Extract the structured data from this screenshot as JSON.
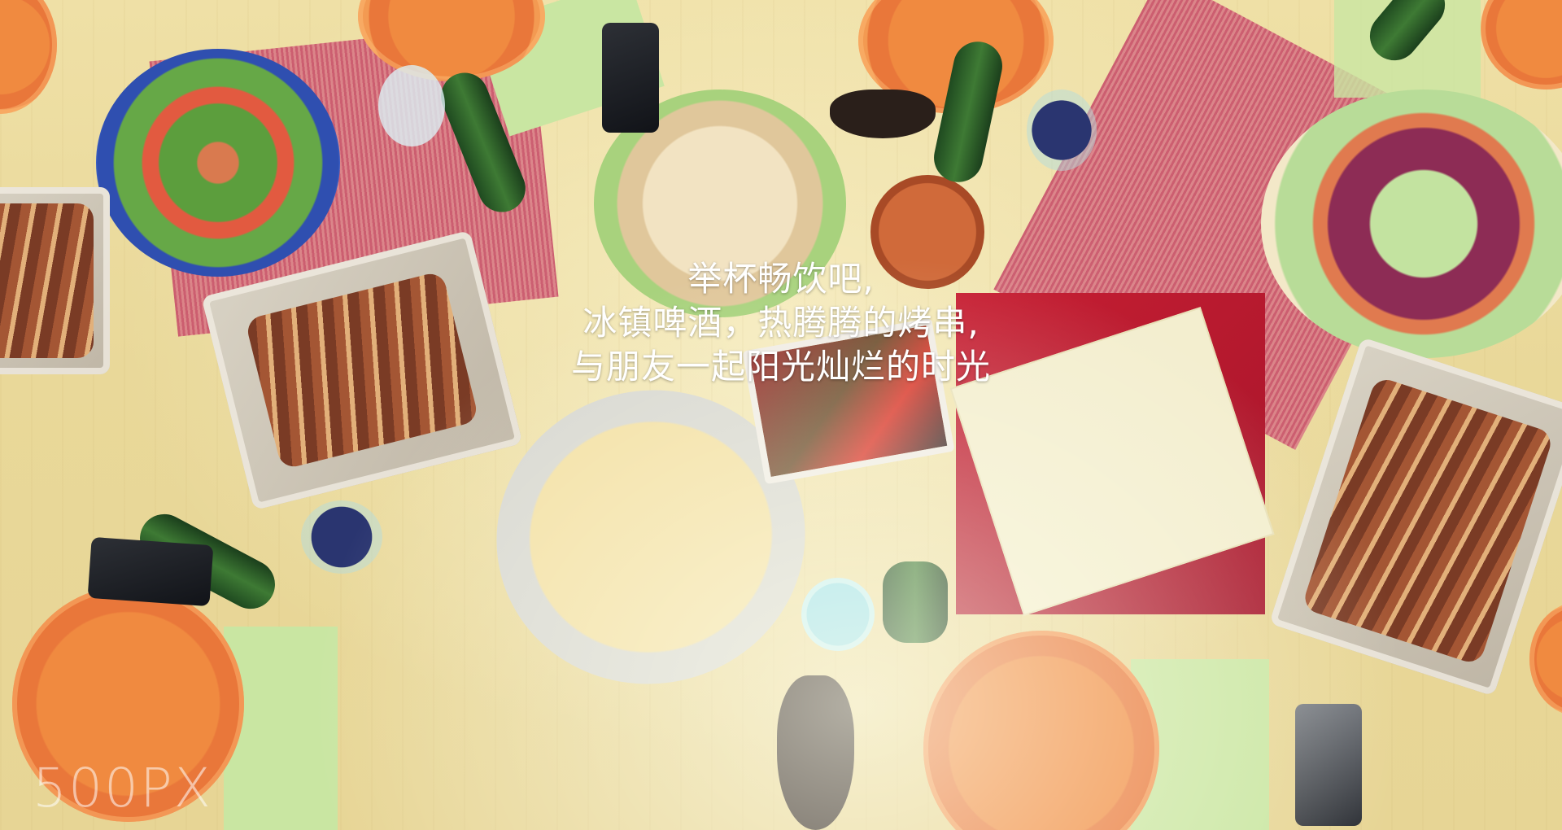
{
  "scene": {
    "description_icon": "food-table-photo-icon"
  },
  "caption": {
    "line1": "举杯畅饮吧,",
    "line2": "冰镇啤酒，热腾腾的烤串,",
    "line3": "与朋友一起阳光灿烂的时光"
  },
  "watermark": {
    "text": "500PX"
  },
  "colors": {
    "caption_text": "#ffffff",
    "table_wood": "#e9d899",
    "plate_orange": "#f08a40",
    "tray_red": "#c71f33"
  }
}
